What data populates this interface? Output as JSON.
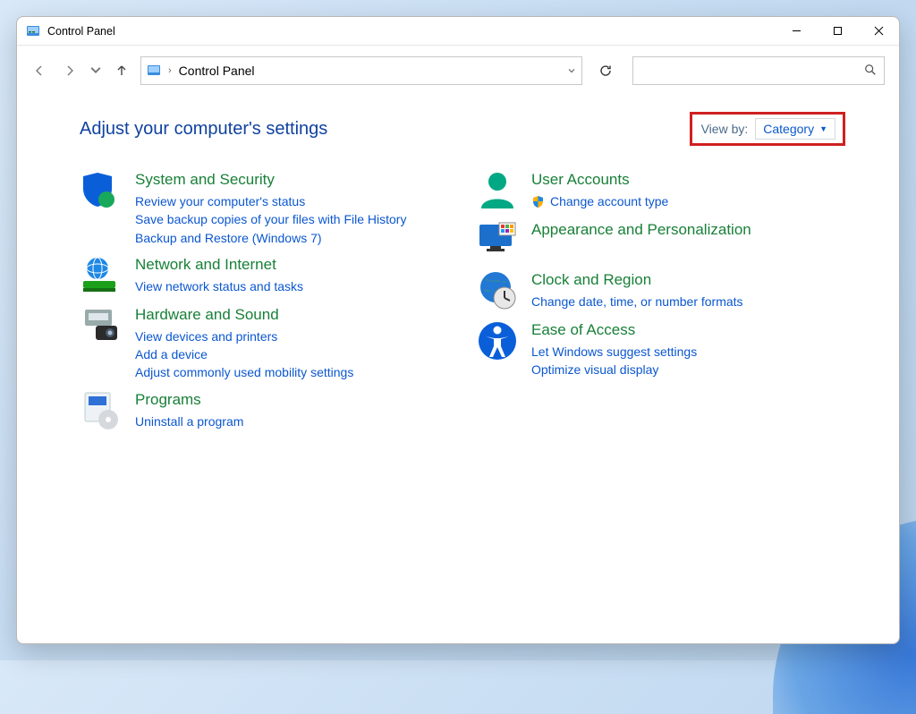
{
  "window": {
    "title": "Control Panel"
  },
  "address": {
    "crumb": "Control Panel"
  },
  "page": {
    "heading": "Adjust your computer's settings",
    "viewby_label": "View by:",
    "viewby_value": "Category"
  },
  "left_col": [
    {
      "icon": "shield-gear",
      "title": "System and Security",
      "links": [
        "Review your computer's status",
        "Save backup copies of your files with File History",
        "Backup and Restore (Windows 7)"
      ]
    },
    {
      "icon": "globe-net",
      "title": "Network and Internet",
      "links": [
        "View network status and tasks"
      ]
    },
    {
      "icon": "printer-cam",
      "title": "Hardware and Sound",
      "links": [
        "View devices and printers",
        "Add a device",
        "Adjust commonly used mobility settings"
      ]
    },
    {
      "icon": "programs-disc",
      "title": "Programs",
      "links": [
        "Uninstall a program"
      ]
    }
  ],
  "right_col": [
    {
      "icon": "user-head",
      "title": "User Accounts",
      "shield_links": [
        "Change account type"
      ]
    },
    {
      "icon": "monitor-colors",
      "title": "Appearance and Personalization",
      "links": []
    },
    {
      "icon": "globe-clock",
      "title": "Clock and Region",
      "links": [
        "Change date, time, or number formats"
      ]
    },
    {
      "icon": "ease-person",
      "title": "Ease of Access",
      "links": [
        "Let Windows suggest settings",
        "Optimize visual display"
      ]
    }
  ]
}
